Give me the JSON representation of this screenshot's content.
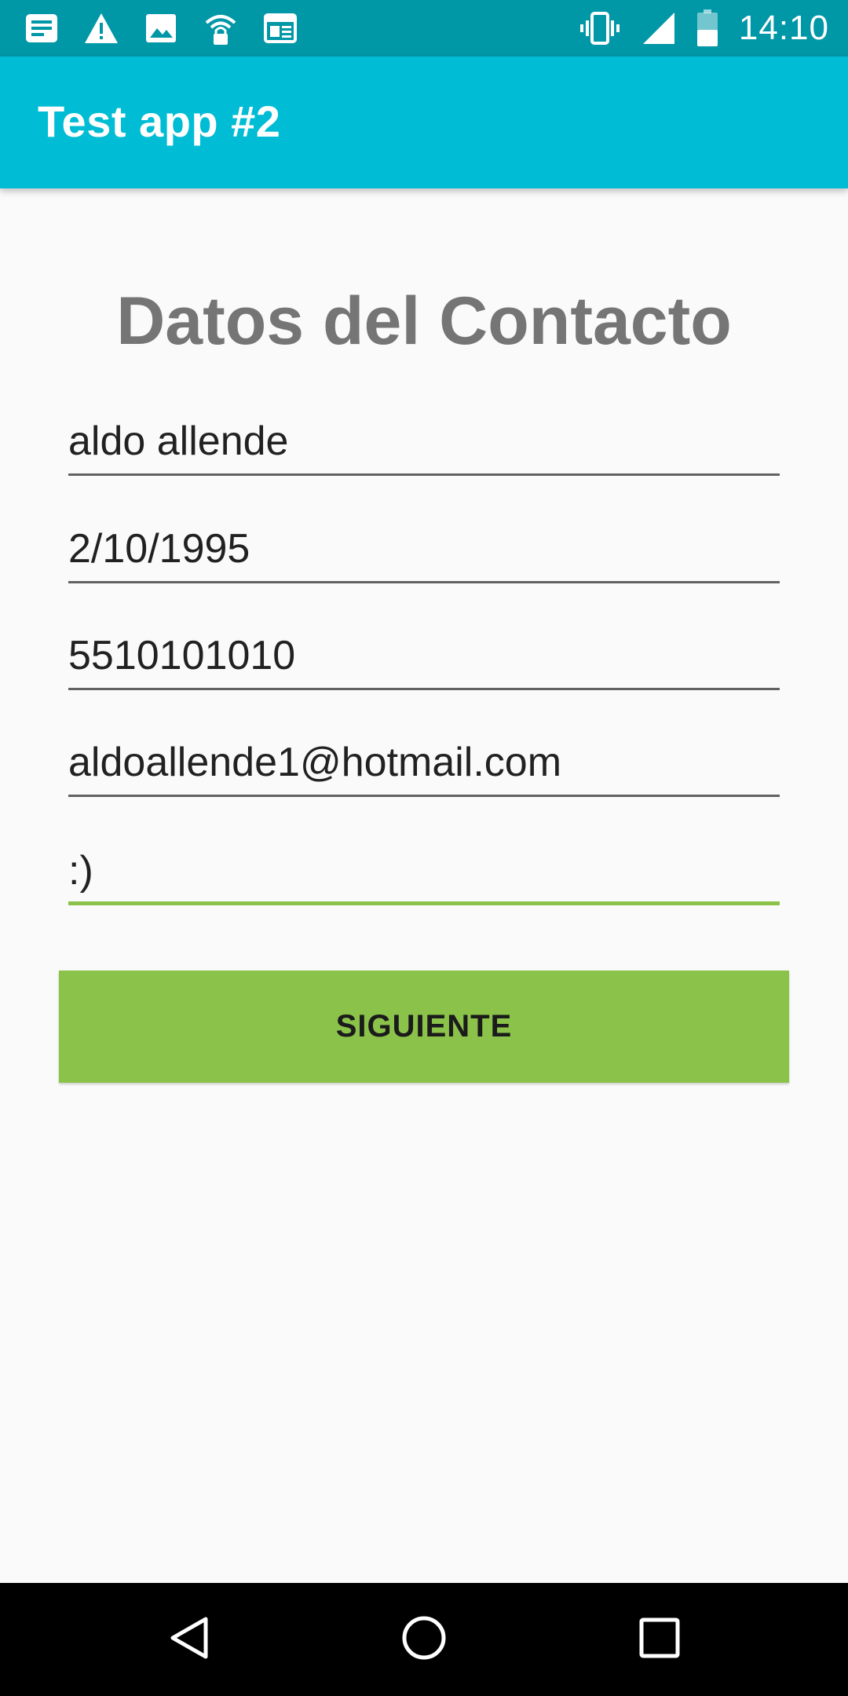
{
  "status_bar": {
    "time": "14:10",
    "left_icons": [
      "news-icon",
      "warning-icon",
      "image-icon",
      "wifi-lock-icon",
      "calendar-icon"
    ],
    "right_icons": [
      "vibrate-icon",
      "signal-icon",
      "battery-icon"
    ]
  },
  "app_bar": {
    "title": "Test app #2"
  },
  "form": {
    "heading": "Datos del Contacto",
    "fields": [
      {
        "value": "aldo allende"
      },
      {
        "value": "2/10/1995"
      },
      {
        "value": "5510101010"
      },
      {
        "value": "aldoallende1@hotmail.com"
      },
      {
        "value": ":)"
      }
    ],
    "button_label": "SIGUIENTE"
  },
  "nav_bar": {
    "icons": [
      "back-icon",
      "home-icon",
      "recents-icon"
    ]
  },
  "colors": {
    "status_bar": "#0097a7",
    "app_bar": "#00bcd4",
    "accent": "#8bc34a",
    "heading": "#757575"
  }
}
